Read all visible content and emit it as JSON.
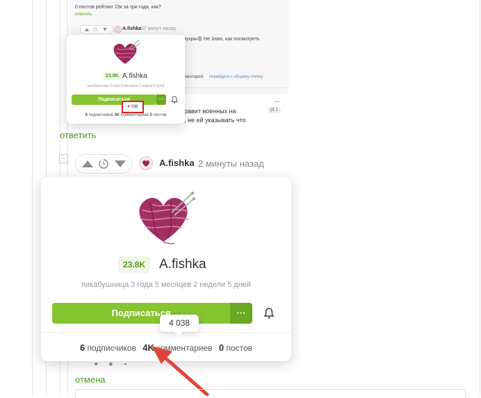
{
  "top_comment": {
    "text": "0 постов рейтинг 23к за три года, как?",
    "reply": "ответить"
  },
  "small_meta": {
    "author": "A.fishka",
    "time": "37 минут назад",
    "snippet_right": "мухры😩 Не знаю, как посмотреть",
    "footer_link_prefix": "ментарий,",
    "footer_link": "перейдите к общему списку",
    "dots": "...",
    "badge": "pl 1",
    "text_line1": "равит военных на",
    "text_line2": ", не ей указывать что"
  },
  "small_card": {
    "rating": "23.8K",
    "name": "A.fishka",
    "tenure": "пикабушница 3 года 5 месяцев 2 недели 5 дней",
    "subscribe": "Подписаться",
    "more": "···",
    "highlight": "4 038",
    "subs_num": "6",
    "subs_label": "подписчиков",
    "comments_num": "4K",
    "comments_label": "комментариев",
    "posts_num": "0",
    "posts_label": "постов"
  },
  "reply_link": "ответить",
  "comment_meta": {
    "author": "A.fishka",
    "time": "2 минуты назад",
    "collapse": "−"
  },
  "big_card": {
    "rating": "23.8K",
    "name": "A.fishka",
    "tenure": "пикабушница 3 года 5 месяцев 2 недели 5 дней",
    "subscribe": "Подписаться",
    "more": "···",
    "tooltip": "4 038",
    "subs_num": "6",
    "subs_label": "подписчиков",
    "comments_num": "4K",
    "comments_label": "комментариев",
    "posts_num": "0",
    "posts_label": "постов"
  },
  "cancel_link": "отмена",
  "colors": {
    "accent_green": "#86c531",
    "accent_green_dark": "#6aa823",
    "link_green": "#4c9a1e",
    "annotation_red": "#e0443a"
  }
}
